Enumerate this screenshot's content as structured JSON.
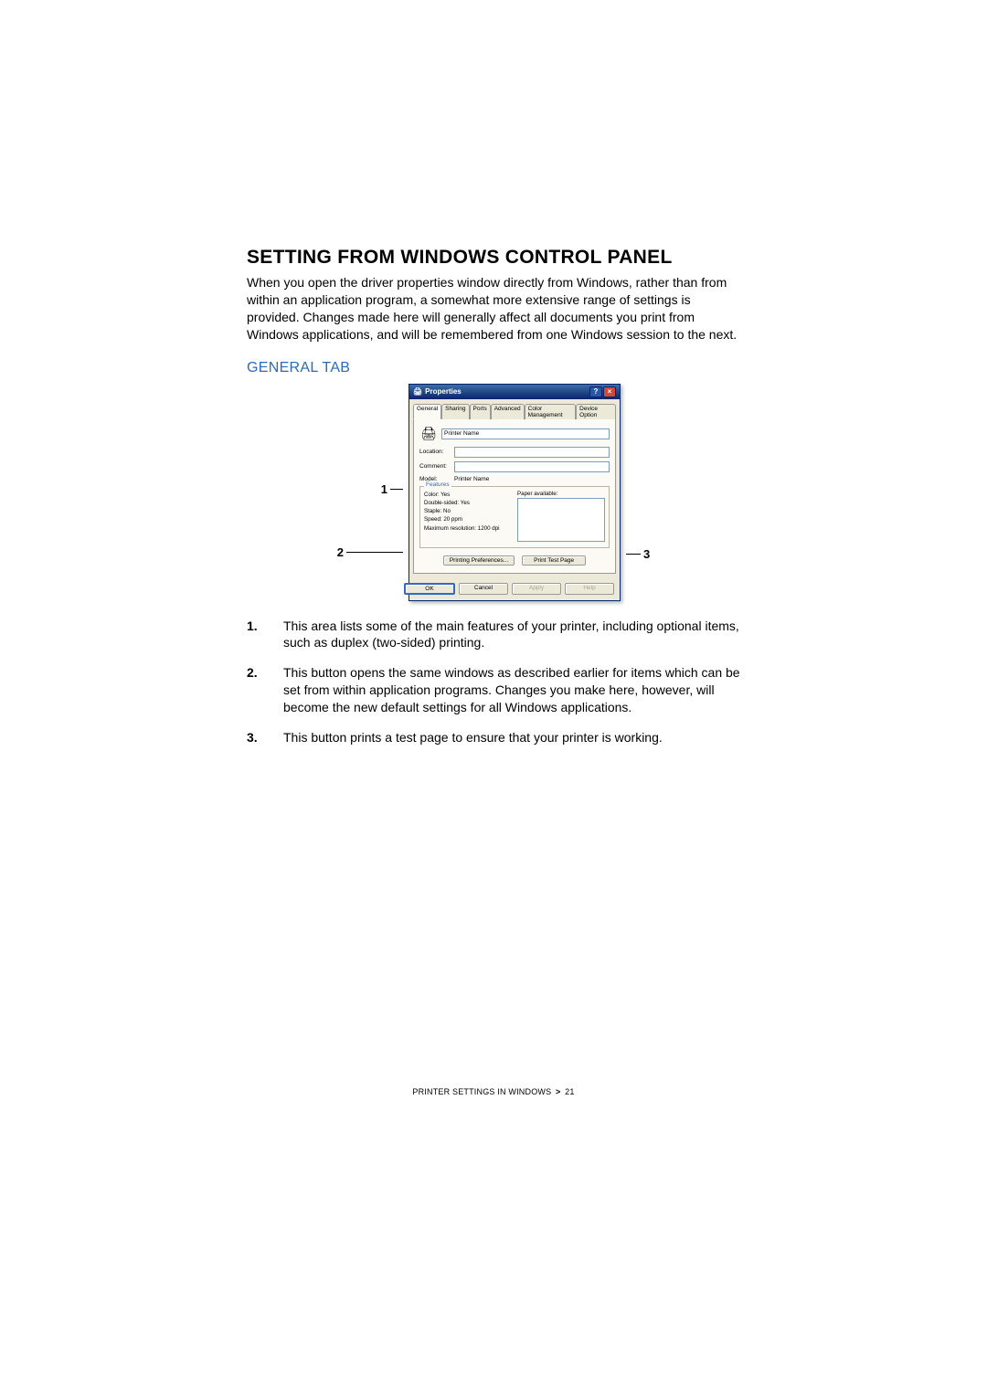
{
  "title": "SETTING FROM WINDOWS CONTROL PANEL",
  "intro": "When you open the driver properties window directly from Windows, rather than from within an application program, a somewhat more extensive range of settings is provided. Changes made here will generally affect all documents you print from Windows applications, and will be remembered from one Windows session to the next.",
  "subheading": "GENERAL TAB",
  "callouts": {
    "left": [
      "1",
      "2"
    ],
    "right": [
      "3"
    ]
  },
  "dialog": {
    "title": "Properties",
    "tabs": [
      "General",
      "Sharing",
      "Ports",
      "Advanced",
      "Color Management",
      "Device Option"
    ],
    "printer_name_label": "Printer Name",
    "location_label": "Location:",
    "comment_label": "Comment:",
    "model_label": "Model:",
    "model_value": "Printer Name",
    "features_legend": "Features",
    "feature_lines": [
      "Color: Yes",
      "Double-sided: Yes",
      "Staple: No",
      "Speed: 20 ppm",
      "Maximum resolution: 1200 dpi"
    ],
    "paper_label": "Paper available:",
    "printing_prefs_btn": "Printing Preferences...",
    "print_test_btn": "Print Test Page",
    "ok_btn": "OK",
    "cancel_btn": "Cancel",
    "apply_btn": "Apply",
    "help_btn": "Help"
  },
  "notes": [
    {
      "num": "1.",
      "text": "This area lists some of the main features of your printer, including optional items, such as duplex (two-sided) printing."
    },
    {
      "num": "2.",
      "text": "This button opens the same windows as described earlier for items which can be set from within application programs. Changes you make here, however, will become the new default settings for all Windows applications."
    },
    {
      "num": "3.",
      "text": "This button prints a test page to ensure that your printer is working."
    }
  ],
  "footer": {
    "section": "PRINTER SETTINGS IN WINDOWS",
    "sep": ">",
    "page": "21"
  }
}
